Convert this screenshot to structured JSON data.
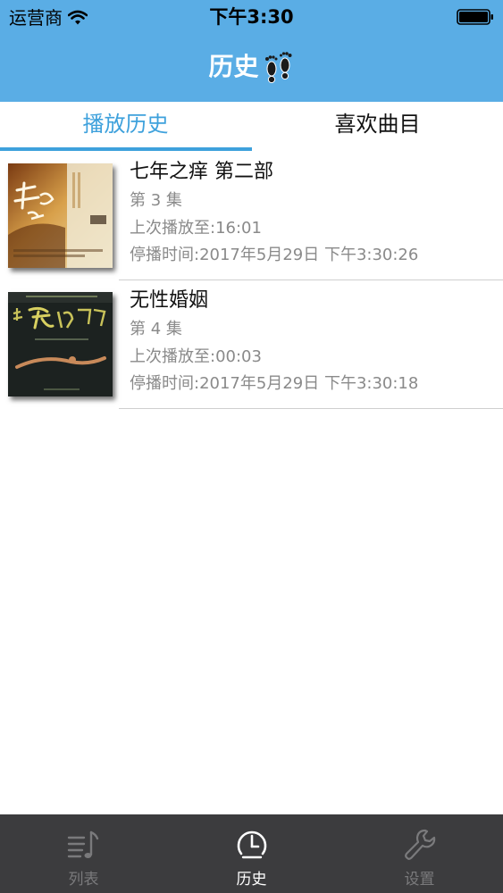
{
  "status_bar": {
    "carrier": "运营商",
    "time": "下午3:30"
  },
  "nav": {
    "title": "历史",
    "icon": "footprints-icon"
  },
  "tabs": [
    {
      "label": "播放历史",
      "selected": true
    },
    {
      "label": "喜欢曲目",
      "selected": false
    }
  ],
  "history": [
    {
      "title": "七年之痒 第二部",
      "episode": "第 3 集",
      "last_position": "上次播放至:16:01",
      "stopped_at": "停播时间:2017年5月29日 下午3:30:26",
      "cover_icon": "book-cover-qinianzhiyang"
    },
    {
      "title": "无性婚姻",
      "episode": "第 4 集",
      "last_position": "上次播放至:00:03",
      "stopped_at": "停播时间:2017年5月29日 下午3:30:18",
      "cover_icon": "book-cover-wuxinghunyin"
    }
  ],
  "tabbar": [
    {
      "label": "列表",
      "icon": "music-list-icon",
      "active": false
    },
    {
      "label": "历史",
      "icon": "clock-icon",
      "active": true
    },
    {
      "label": "设置",
      "icon": "wrench-icon",
      "active": false
    }
  ],
  "colors": {
    "nav_background": "#5aade5",
    "accent": "#3ea1dc",
    "tabbar_background": "#3c3c3e"
  }
}
